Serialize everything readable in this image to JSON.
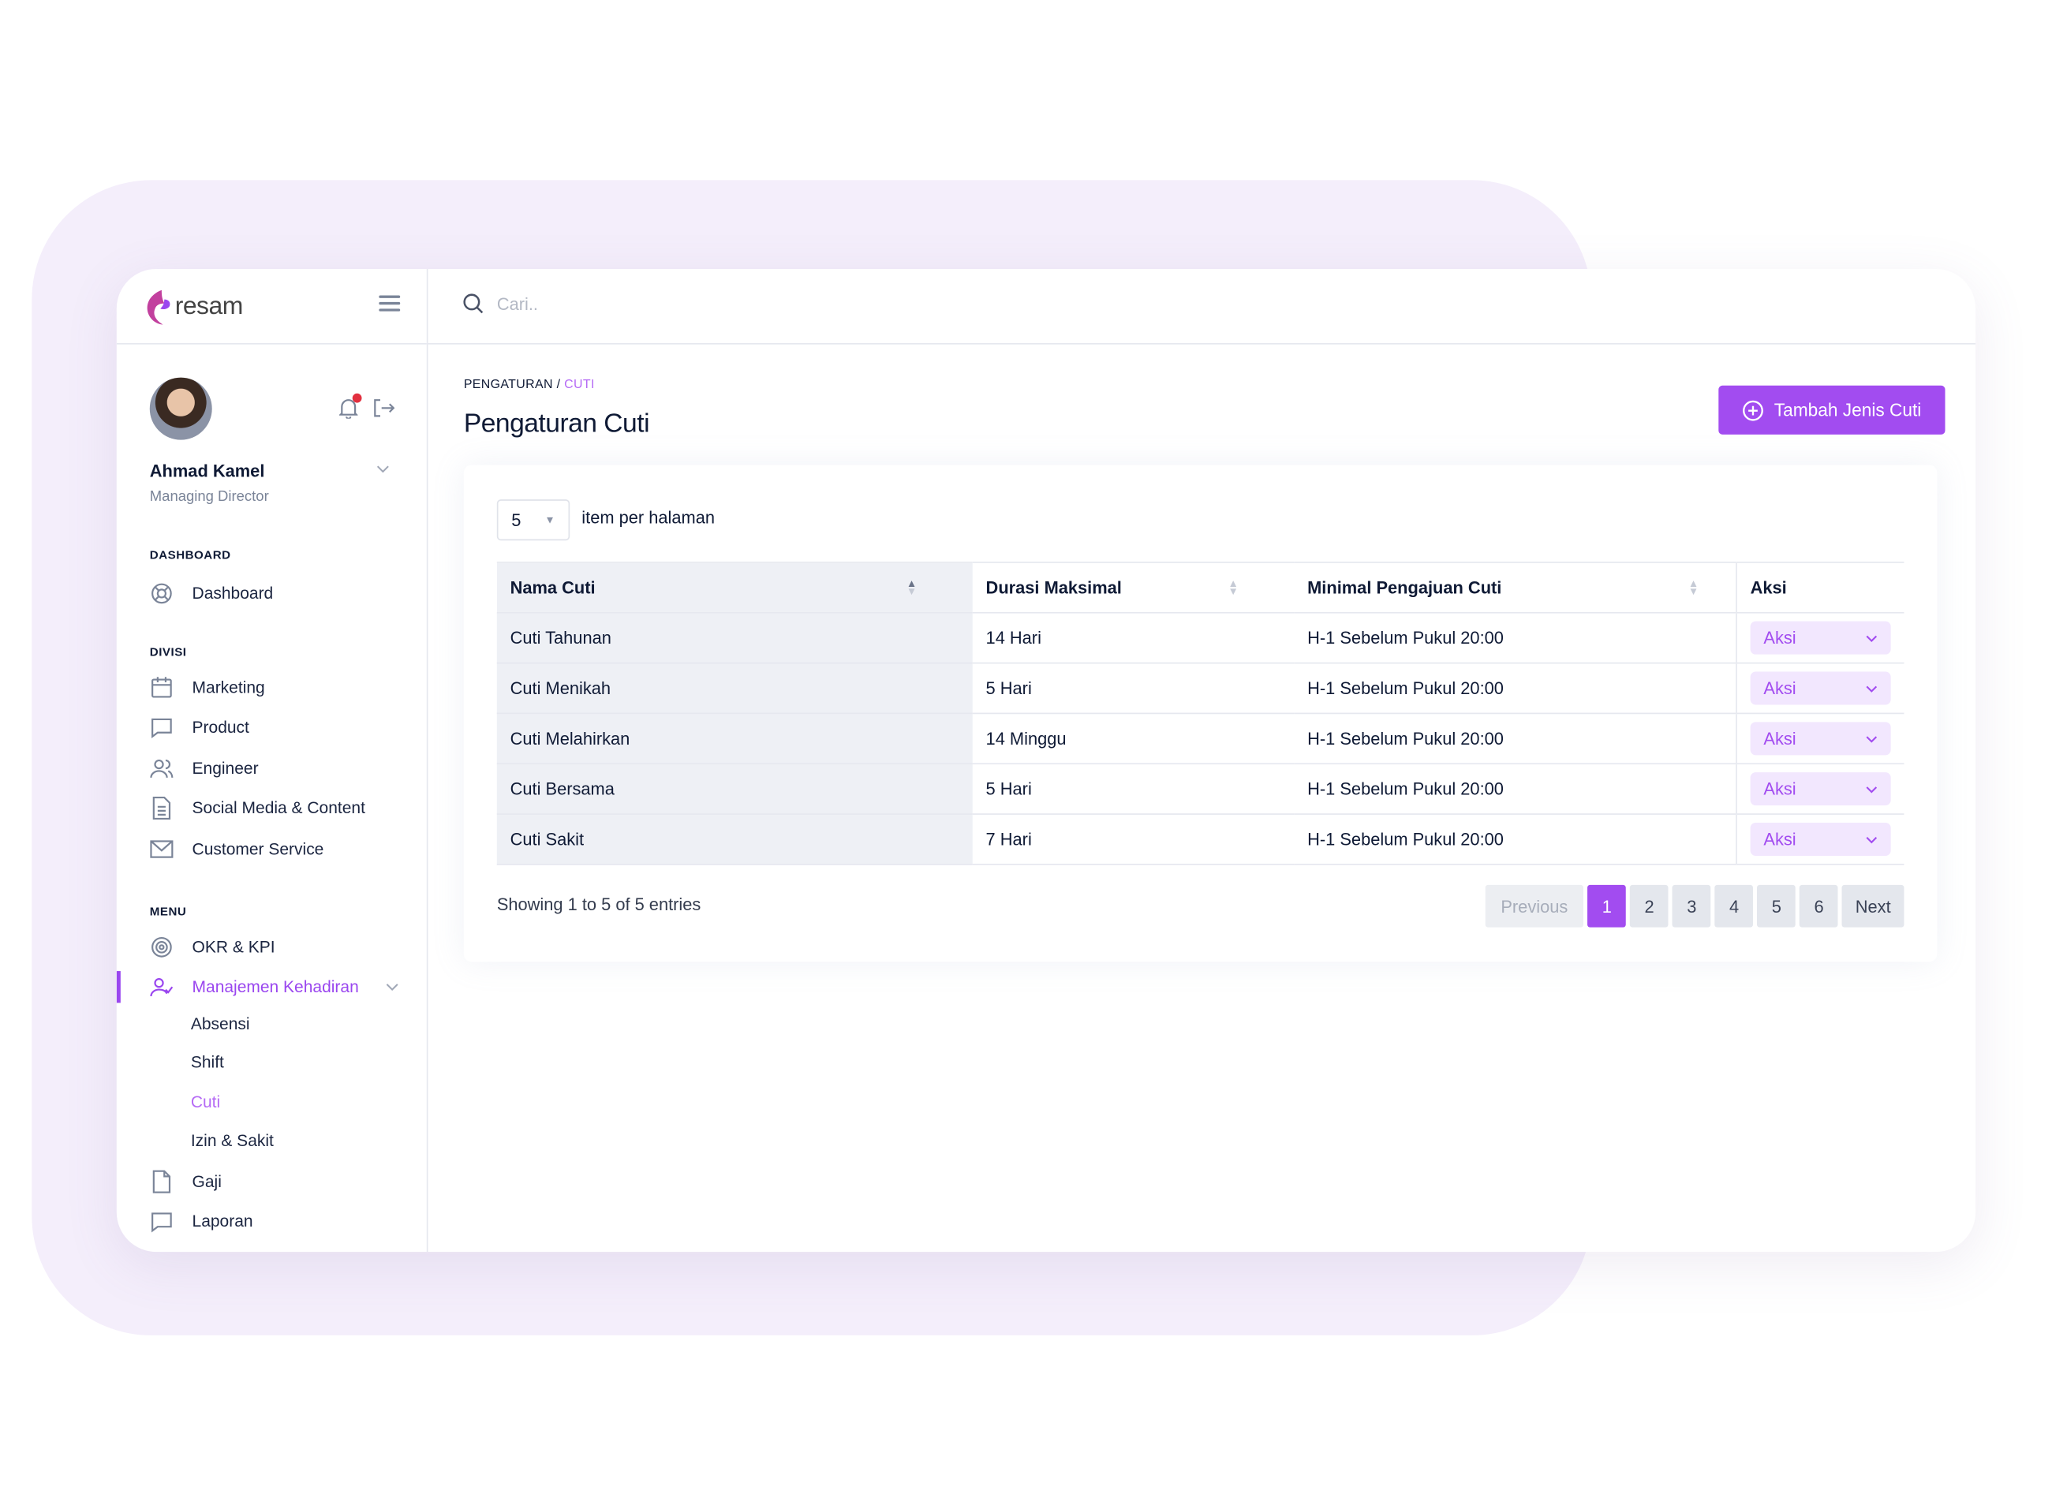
{
  "brand": {
    "logo_text": "resam",
    "accent": "#a24cf0"
  },
  "user": {
    "name": "Ahmad Kamel",
    "role": "Managing Director"
  },
  "search": {
    "placeholder": "Cari.."
  },
  "sidebar": {
    "sections": {
      "dashboard": "DASHBOARD",
      "divisi": "DIVISI",
      "menu": "MENU"
    },
    "dashboard": [
      {
        "label": "Dashboard",
        "icon": "dashboard-icon"
      }
    ],
    "divisi": [
      {
        "label": "Marketing",
        "icon": "calendar-icon"
      },
      {
        "label": "Product",
        "icon": "chat-icon"
      },
      {
        "label": "Engineer",
        "icon": "users-icon"
      },
      {
        "label": "Social Media & Content",
        "icon": "document-icon"
      },
      {
        "label": "Customer Service",
        "icon": "mail-icon"
      }
    ],
    "menu": [
      {
        "label": "OKR & KPI",
        "icon": "target-icon"
      },
      {
        "label": "Manajemen Kehadiran",
        "icon": "user-check-icon",
        "active": true
      },
      {
        "label": "Gaji",
        "icon": "file-icon"
      },
      {
        "label": "Laporan",
        "icon": "chat-icon"
      }
    ],
    "submenu": [
      {
        "label": "Absensi"
      },
      {
        "label": "Shift"
      },
      {
        "label": "Cuti",
        "active": true
      },
      {
        "label": "Izin & Sakit"
      }
    ]
  },
  "breadcrumb": {
    "parent": "PENGATURAN",
    "separator": " / ",
    "current": "CUTI"
  },
  "page": {
    "title": "Pengaturan Cuti",
    "add_button": "Tambah Jenis Cuti"
  },
  "table": {
    "per_page": "5",
    "per_page_label": "item per halaman",
    "headers": [
      "Nama Cuti",
      "Durasi Maksimal",
      "Minimal Pengajuan Cuti",
      "Aksi"
    ],
    "rows": [
      {
        "nama": "Cuti Tahunan",
        "durasi": "14 Hari",
        "minimal": "H-1 Sebelum Pukul 20:00",
        "aksi": "Aksi"
      },
      {
        "nama": "Cuti Menikah",
        "durasi": "5 Hari",
        "minimal": "H-1 Sebelum Pukul 20:00",
        "aksi": "Aksi"
      },
      {
        "nama": "Cuti Melahirkan",
        "durasi": "14 Minggu",
        "minimal": "H-1 Sebelum Pukul 20:00",
        "aksi": "Aksi"
      },
      {
        "nama": "Cuti Bersama",
        "durasi": "5 Hari",
        "minimal": "H-1 Sebelum Pukul 20:00",
        "aksi": "Aksi"
      },
      {
        "nama": "Cuti Sakit",
        "durasi": "7 Hari",
        "minimal": "H-1 Sebelum Pukul 20:00",
        "aksi": "Aksi"
      }
    ],
    "showing": "Showing 1 to 5 of 5 entries"
  },
  "pagination": {
    "previous": "Previous",
    "pages": [
      "1",
      "2",
      "3",
      "4",
      "5",
      "6"
    ],
    "current": "1",
    "next": "Next"
  }
}
